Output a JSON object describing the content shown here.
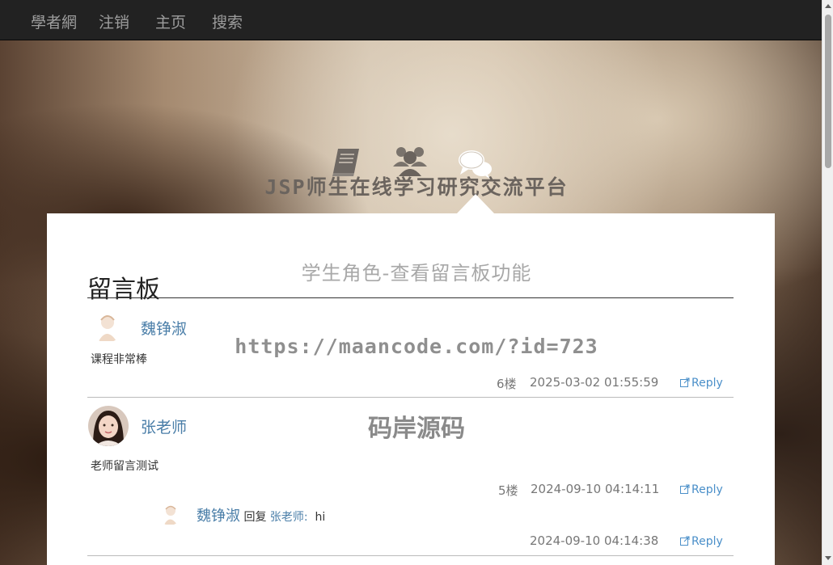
{
  "nav": {
    "brand": "學者網",
    "items": [
      "注销",
      "主页",
      "搜索"
    ]
  },
  "hero": {
    "icons": [
      "book-icon",
      "users-icon",
      "comments-icon"
    ],
    "title": "JSP师生在线学习研究交流平台"
  },
  "watermarks": {
    "subtitle": "学生角色-查看留言板功能",
    "url": "https://maancode.com/?id=723",
    "brand": "码岸源码"
  },
  "board": {
    "title": "留言板",
    "messages": [
      {
        "author": "魏铮淑",
        "text": "课程非常棒",
        "floor": "6楼",
        "time": "2025-03-02 01:55:59",
        "reply_label": "Reply"
      },
      {
        "author": "张老师",
        "text": "老师留言测试",
        "floor": "5楼",
        "time": "2024-09-10 04:14:11",
        "reply_label": "Reply",
        "replies": [
          {
            "author": "魏铮淑",
            "reply_word": "回复",
            "target": "张老师:",
            "text": "hi",
            "time": "2024-09-10 04:14:38",
            "reply_label": "Reply"
          }
        ]
      }
    ]
  },
  "colors": {
    "navbar": "#222222",
    "link": "#4a7ea8",
    "reply": "#4a8fc9"
  }
}
